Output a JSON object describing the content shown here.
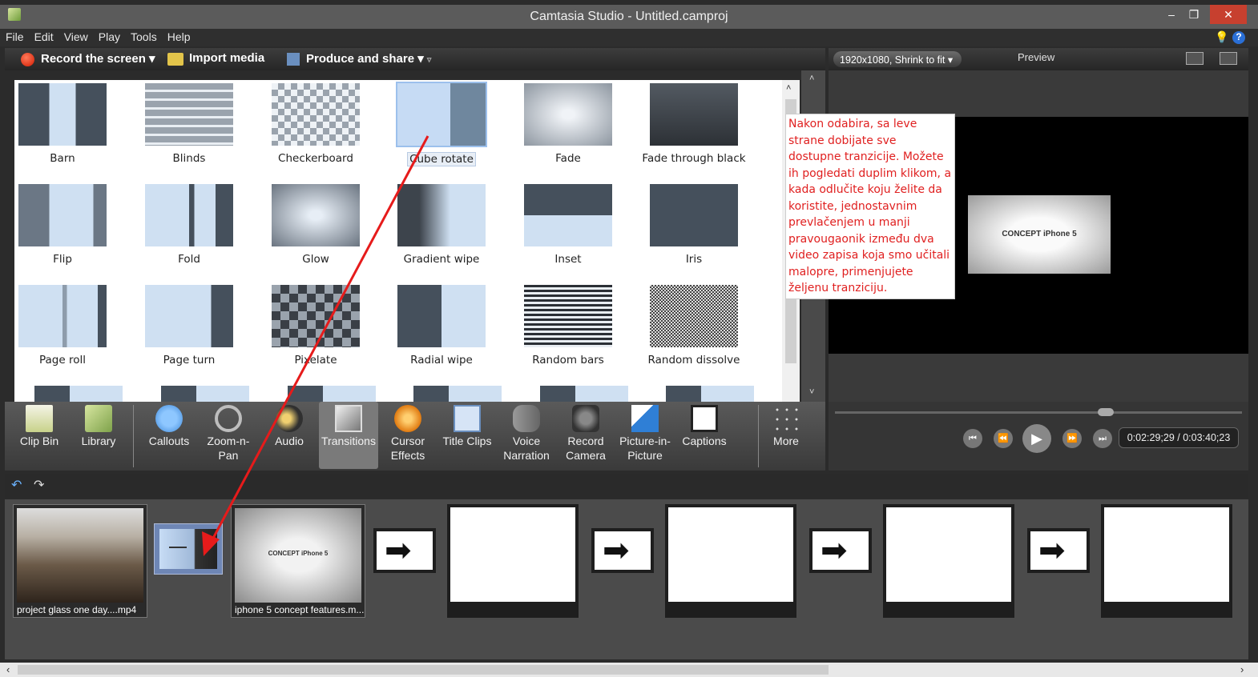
{
  "window": {
    "title": "Camtasia Studio - Untitled.camproj"
  },
  "menu": [
    "File",
    "Edit",
    "View",
    "Play",
    "Tools",
    "Help"
  ],
  "toolbar": {
    "record": "Record the screen",
    "import": "Import media",
    "produce": "Produce and share"
  },
  "preview": {
    "resolution": "1920x1080, Shrink to fit",
    "label": "Preview",
    "time": "0:02:29;29 / 0:03:40;23",
    "frame_text": "CONCEPT iPhone 5"
  },
  "transitions": [
    {
      "label": "Barn"
    },
    {
      "label": "Blinds"
    },
    {
      "label": "Checkerboard"
    },
    {
      "label": "Cube rotate"
    },
    {
      "label": "Fade"
    },
    {
      "label": "Fade through black"
    },
    {
      "label": "Flip"
    },
    {
      "label": "Fold"
    },
    {
      "label": "Glow"
    },
    {
      "label": "Gradient wipe"
    },
    {
      "label": "Inset"
    },
    {
      "label": "Iris"
    },
    {
      "label": "Page roll"
    },
    {
      "label": "Page turn"
    },
    {
      "label": "Pixelate"
    },
    {
      "label": "Radial wipe"
    },
    {
      "label": "Random bars"
    },
    {
      "label": "Random dissolve"
    }
  ],
  "annotation": "Nakon odabira, sa leve strane dobijate sve dostupne tranzicije. Možete ih pogledati duplim klikom, a kada odlučite koju želite da koristite, jednostavnim prevlačenjem u manji pravougaonik između dva video zapisa koja smo učitali malopre, primenjujete željenu tranziciju.",
  "tabs": [
    {
      "label": "Clip Bin",
      "icon": "clip-bin-icon"
    },
    {
      "label": "Library",
      "icon": "library-icon"
    },
    {
      "label": "Callouts",
      "icon": "callouts-icon"
    },
    {
      "label": "Zoom-n-Pan",
      "icon": "zoom-icon"
    },
    {
      "label": "Audio",
      "icon": "audio-icon"
    },
    {
      "label": "Transitions",
      "icon": "transitions-icon"
    },
    {
      "label": "Cursor Effects",
      "icon": "cursor-icon"
    },
    {
      "label": "Title Clips",
      "icon": "title-icon"
    },
    {
      "label": "Voice Narration",
      "icon": "microphone-icon"
    },
    {
      "label": "Record Camera",
      "icon": "camera-icon"
    },
    {
      "label": "Picture-in-Picture",
      "icon": "pip-icon"
    },
    {
      "label": "Captions",
      "icon": "cc-icon"
    },
    {
      "label": "More",
      "icon": "more-icon"
    }
  ],
  "storyboard": {
    "clips": [
      {
        "caption": "project glass one day....mp4"
      },
      {
        "caption": "iphone 5 concept features.m..."
      }
    ]
  },
  "colors": {
    "accent_red": "#e02020",
    "active_tab": "#7a7a7a"
  }
}
